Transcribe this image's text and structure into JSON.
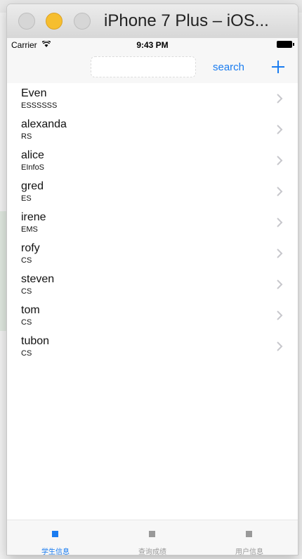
{
  "window": {
    "title": "iPhone 7 Plus – iOS..."
  },
  "status_bar": {
    "carrier": "Carrier",
    "time": "9:43 PM"
  },
  "nav_bar": {
    "search_value": "",
    "search_label": "search",
    "add_icon": "plus-icon"
  },
  "students": [
    {
      "name": "Even",
      "major": "ESSSSSS"
    },
    {
      "name": "alexanda",
      "major": "RS"
    },
    {
      "name": "alice",
      "major": "EInfoS"
    },
    {
      "name": "gred",
      "major": "ES"
    },
    {
      "name": "irene",
      "major": "EMS"
    },
    {
      "name": "rofy",
      "major": "CS"
    },
    {
      "name": "steven",
      "major": "CS"
    },
    {
      "name": "tom",
      "major": "CS"
    },
    {
      "name": "tubon",
      "major": "CS"
    }
  ],
  "tabs": [
    {
      "label": "学生信息",
      "selected": true
    },
    {
      "label": "查询成绩",
      "selected": false
    },
    {
      "label": "用户信息",
      "selected": false
    }
  ],
  "colors": {
    "accent": "#1a7cf0",
    "tab_inactive": "#999999",
    "chevron": "#c7c7cc"
  }
}
